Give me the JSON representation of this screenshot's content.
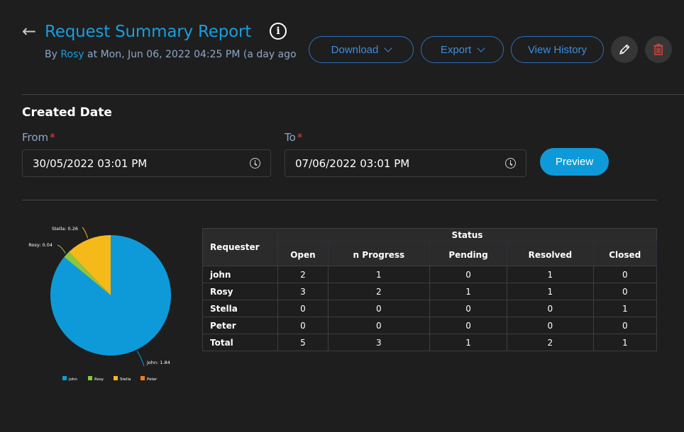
{
  "header": {
    "back_icon": "arrow-left-icon",
    "title": "Request Summary Report",
    "info_icon": "info-circle-icon",
    "subtitle_prefix": "By ",
    "author": "Rosy",
    "subtitle_suffix": " at Mon, Jun 06, 2022 04:25 PM (a day ago"
  },
  "actions": {
    "download_label": "Download",
    "export_label": "Export",
    "history_label": "View History",
    "edit_icon": "pencil-icon",
    "delete_icon": "trash-icon"
  },
  "filters": {
    "section_title": "Created Date",
    "from_label": "From",
    "to_label": "To",
    "required_mark": "*",
    "from_value": "30/05/2022 03:01 PM",
    "to_value": "07/06/2022 03:01 PM",
    "preview_label": "Preview"
  },
  "colors": {
    "accent": "#1a9ddb",
    "john": "#0e9ad9",
    "Rosy": "#8cc63f",
    "Stella": "#f6b91a",
    "Peter": "#f47c20",
    "delete": "#e0453a"
  },
  "chart_data": {
    "type": "pie",
    "title": "",
    "slices": [
      {
        "label": "john",
        "value": 1.84,
        "display": "john: 1.84",
        "color": "#0e9ad9"
      },
      {
        "label": "Rosy",
        "value": 0.04,
        "display": "Rosy: 0.04",
        "color": "#8cc63f"
      },
      {
        "label": "Stella",
        "value": 0.26,
        "display": "Stella: 0.26",
        "color": "#f6b91a"
      },
      {
        "label": "Peter",
        "value": 0,
        "display": "",
        "color": "#f47c20"
      }
    ],
    "legend": [
      "john",
      "Rosy",
      "Stella",
      "Peter"
    ],
    "legend_position": "bottom"
  },
  "table": {
    "requester_header": "Requester",
    "group_header": "Status",
    "columns": [
      "Open",
      "n Progress",
      "Pending",
      "Resolved",
      "Closed"
    ],
    "rows": [
      {
        "name": "john",
        "values": [
          "2",
          "1",
          "0",
          "1",
          "0"
        ]
      },
      {
        "name": "Rosy",
        "values": [
          "3",
          "2",
          "1",
          "1",
          "0"
        ]
      },
      {
        "name": "Stella",
        "values": [
          "0",
          "0",
          "0",
          "0",
          "1"
        ]
      },
      {
        "name": "Peter",
        "values": [
          "0",
          "0",
          "0",
          "0",
          "0"
        ]
      },
      {
        "name": "Total",
        "values": [
          "5",
          "3",
          "1",
          "2",
          "1"
        ]
      }
    ]
  }
}
